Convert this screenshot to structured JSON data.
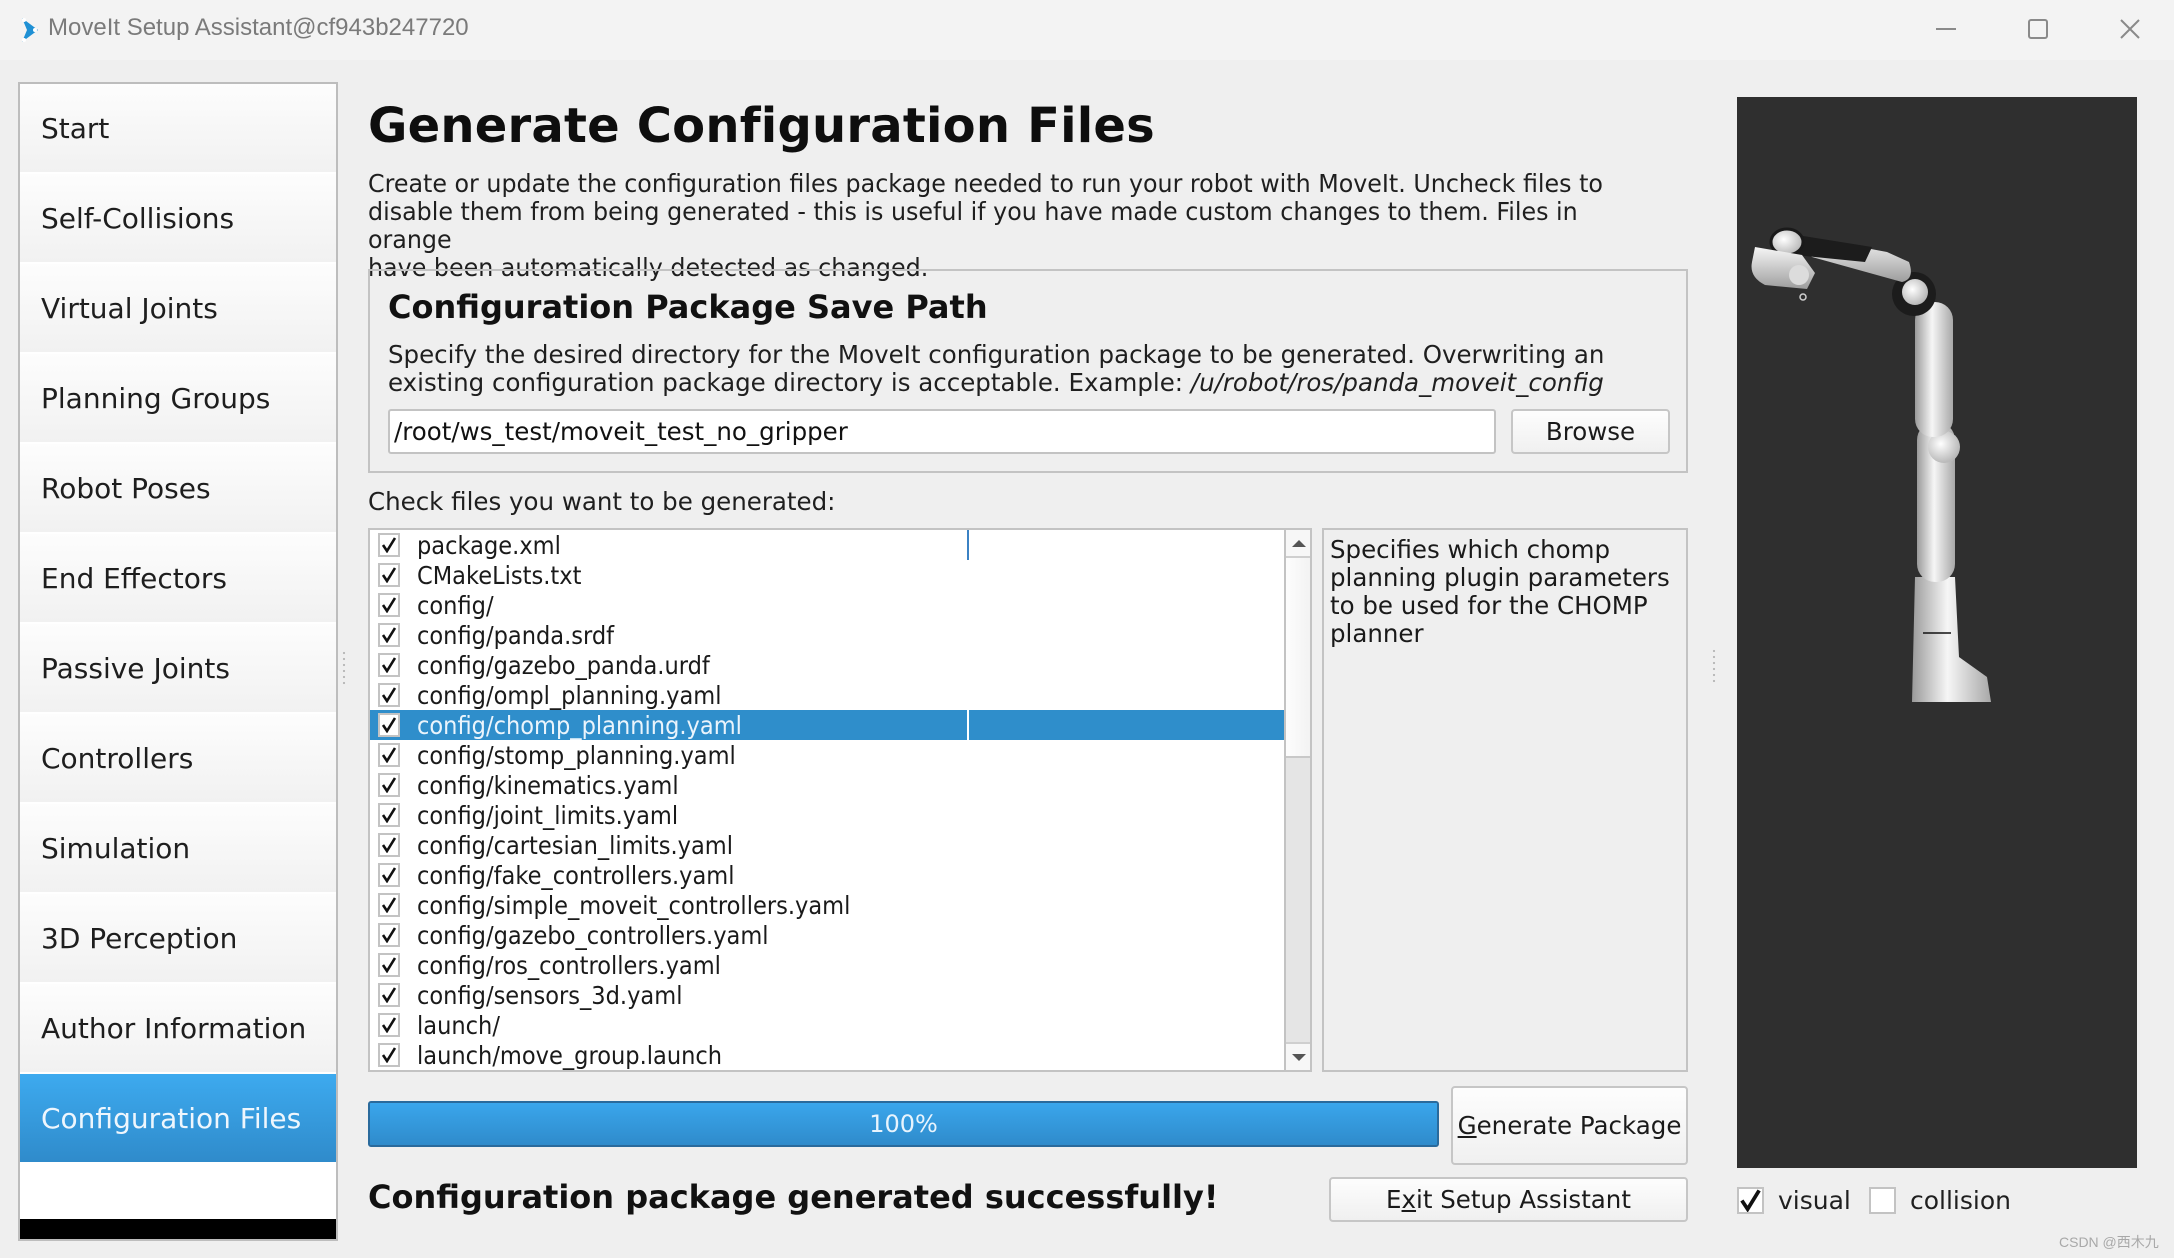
{
  "window": {
    "title": "MoveIt Setup Assistant@cf943b247720",
    "app_icon": "moveit-logo-icon",
    "controls": [
      "minimize-icon",
      "maximize-icon",
      "close-icon"
    ]
  },
  "sidebar": {
    "selected_index": 11,
    "items": [
      {
        "label": "Start"
      },
      {
        "label": "Self-Collisions"
      },
      {
        "label": "Virtual Joints"
      },
      {
        "label": "Planning Groups"
      },
      {
        "label": "Robot Poses"
      },
      {
        "label": "End Effectors"
      },
      {
        "label": "Passive Joints"
      },
      {
        "label": "Controllers"
      },
      {
        "label": "Simulation"
      },
      {
        "label": "3D Perception"
      },
      {
        "label": "Author Information"
      },
      {
        "label": "Configuration Files"
      }
    ]
  },
  "main": {
    "title": "Generate Configuration Files",
    "description": "Create or update the configuration files package needed to run your robot with MoveIt. Uncheck files to\ndisable them from being generated - this is useful if you have made custom changes to them. Files in orange\nhave been automatically detected as changed.",
    "save_path": {
      "title": "Configuration Package Save Path",
      "description_line1": "Specify the desired directory for the MoveIt configuration package to be generated. Overwriting an",
      "description_line2": "existing configuration package directory is acceptable. Example: ",
      "example_path": "/u/robot/ros/panda_moveit_config",
      "input_value": "/root/ws_test/moveit_test_no_gripper",
      "browse_label": "Browse"
    },
    "files_label": "Check files you want to be generated:",
    "files": [
      {
        "name": "package.xml",
        "checked": true
      },
      {
        "name": "CMakeLists.txt",
        "checked": true
      },
      {
        "name": "config/",
        "checked": true
      },
      {
        "name": "config/panda.srdf",
        "checked": true
      },
      {
        "name": "config/gazebo_panda.urdf",
        "checked": true
      },
      {
        "name": "config/ompl_planning.yaml",
        "checked": true
      },
      {
        "name": "config/chomp_planning.yaml",
        "checked": true,
        "selected": true
      },
      {
        "name": "config/stomp_planning.yaml",
        "checked": true
      },
      {
        "name": "config/kinematics.yaml",
        "checked": true
      },
      {
        "name": "config/joint_limits.yaml",
        "checked": true
      },
      {
        "name": "config/cartesian_limits.yaml",
        "checked": true
      },
      {
        "name": "config/fake_controllers.yaml",
        "checked": true
      },
      {
        "name": "config/simple_moveit_controllers.yaml",
        "checked": true
      },
      {
        "name": "config/gazebo_controllers.yaml",
        "checked": true
      },
      {
        "name": "config/ros_controllers.yaml",
        "checked": true
      },
      {
        "name": "config/sensors_3d.yaml",
        "checked": true
      },
      {
        "name": "launch/",
        "checked": true
      },
      {
        "name": "launch/move_group.launch",
        "checked": true
      }
    ],
    "file_description": "Specifies which chomp\nplanning plugin parameters\nto be used for the CHOMP\nplanner",
    "progress": {
      "value_percent": 100,
      "label": "100%"
    },
    "generate_button": {
      "mnemonic": "G",
      "rest": "enerate Package"
    },
    "exit_button": {
      "before": "E",
      "mnemonic": "x",
      "rest": "it Setup Assistant"
    },
    "status_message": "Configuration package generated successfully!"
  },
  "viewer": {
    "background": "#2f2f2f",
    "visual": {
      "label": "visual",
      "checked": true
    },
    "collision": {
      "label": "collision",
      "checked": false
    }
  },
  "watermark": "CSDN @西木九",
  "colors": {
    "accent": "#2f8ecb",
    "selected_nav_top": "#3daaef",
    "selected_nav_bottom": "#2f8bcb"
  }
}
